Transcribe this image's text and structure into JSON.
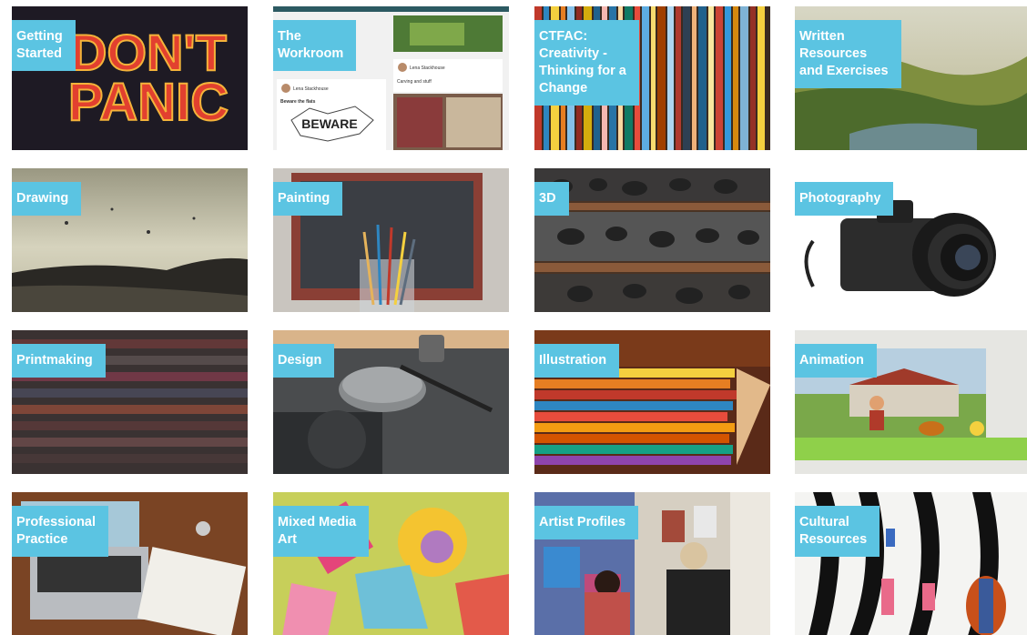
{
  "tiles": [
    {
      "label": "Getting\nStarted",
      "icon": "dont-panic-image"
    },
    {
      "label": "The\nWorkroom",
      "icon": "workroom-screenshot-image"
    },
    {
      "label": "CTFAC:\nCreativity -\nThinking for a\nChange",
      "icon": "colored-paint-strips-image"
    },
    {
      "label": "Written\nResources\nand Exercises",
      "icon": "landscape-painting-image"
    },
    {
      "label": "Drawing",
      "icon": "charcoal-dust-image"
    },
    {
      "label": "Painting",
      "icon": "paint-brushes-image"
    },
    {
      "label": "3D",
      "icon": "clay-pieces-shelf-image"
    },
    {
      "label": "Photography",
      "icon": "camera-image"
    },
    {
      "label": "Printmaking",
      "icon": "letterpress-type-image"
    },
    {
      "label": "Design",
      "icon": "mouse-and-pen-image"
    },
    {
      "label": "Illustration",
      "icon": "colored-pencils-image"
    },
    {
      "label": "Animation",
      "icon": "clay-animation-image"
    },
    {
      "label": "Professional\nPractice",
      "icon": "laptop-desk-image"
    },
    {
      "label": "Mixed Media\nArt",
      "icon": "mixed-media-collage-image"
    },
    {
      "label": "Artist Profiles",
      "icon": "gallery-visitors-image"
    },
    {
      "label": "Cultural\nResources",
      "icon": "tribal-pattern-image"
    }
  ],
  "colors": {
    "label_bg": "#5bc4e2",
    "label_text": "#ffffff"
  },
  "image_text": {
    "dont_panic_line1": "DON'T",
    "dont_panic_line2": "PANIC",
    "workroom_user": "Lena Stackhouse",
    "workroom_post": "Carving and stuff",
    "workroom_beware": "Beware the flats",
    "workroom_sketch": "BEWARE"
  }
}
